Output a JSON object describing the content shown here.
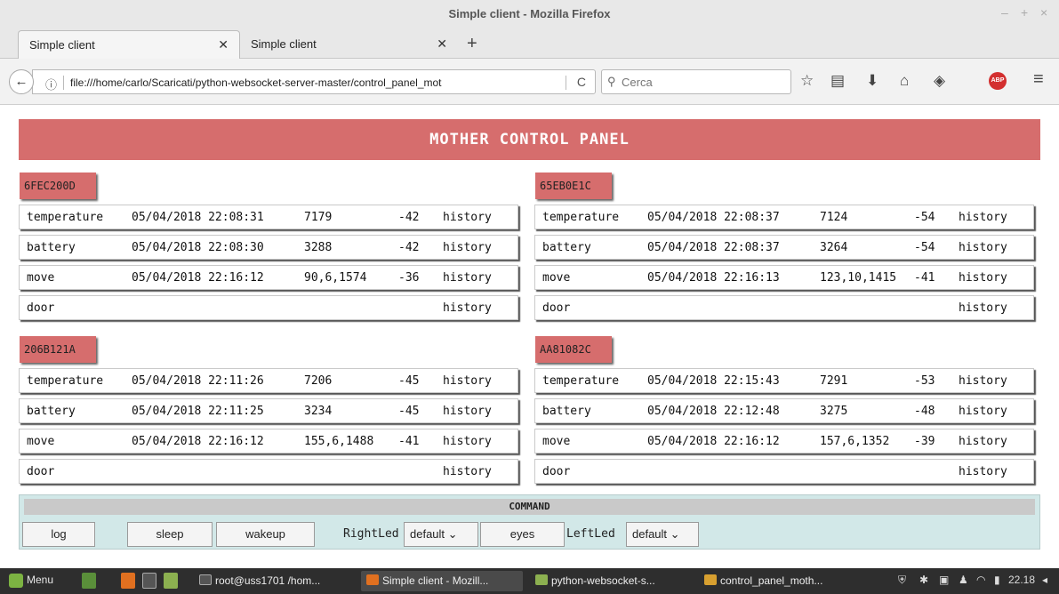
{
  "window": {
    "title": "Simple client - Mozilla Firefox",
    "controls": [
      "–",
      "+",
      "×"
    ]
  },
  "tabs": [
    {
      "label": "Simple client"
    },
    {
      "label": "Simple client"
    }
  ],
  "newtab_label": "+",
  "nav": {
    "back": "←",
    "info": "ⓘ",
    "url": "file:///home/carlo/Scaricati/python-websocket-server-master/control_panel_mot",
    "reload": "C",
    "search_placeholder": "Cerca",
    "search_icon": "⚲",
    "toolbar": {
      "bookmark": "☆",
      "reader": "▤",
      "download": "⬇",
      "home": "⌂",
      "pocket": "◈",
      "abp": "ABP",
      "menu": "≡"
    }
  },
  "page": {
    "banner": "MOTHER CONTROL PANEL",
    "devices": [
      {
        "id": "6FEC200D",
        "rows": [
          {
            "name": "temperature",
            "time": "05/04/2018 22:08:31",
            "value": "7179",
            "rssi": "-42",
            "link": "history"
          },
          {
            "name": "battery",
            "time": "05/04/2018 22:08:30",
            "value": "3288",
            "rssi": "-42",
            "link": "history"
          },
          {
            "name": "move",
            "time": "05/04/2018 22:16:12",
            "value": "90,6,1574",
            "rssi": "-36",
            "link": "history"
          },
          {
            "name": "door",
            "time": "",
            "value": "",
            "rssi": "",
            "link": "history"
          }
        ]
      },
      {
        "id": "65EB0E1C",
        "rows": [
          {
            "name": "temperature",
            "time": "05/04/2018 22:08:37",
            "value": "7124",
            "rssi": "-54",
            "link": "history"
          },
          {
            "name": "battery",
            "time": "05/04/2018 22:08:37",
            "value": "3264",
            "rssi": "-54",
            "link": "history"
          },
          {
            "name": "move",
            "time": "05/04/2018 22:16:13",
            "value": "123,10,1415",
            "rssi": "-41",
            "link": "history"
          },
          {
            "name": "door",
            "time": "",
            "value": "",
            "rssi": "",
            "link": "history"
          }
        ]
      },
      {
        "id": "206B121A",
        "rows": [
          {
            "name": "temperature",
            "time": "05/04/2018 22:11:26",
            "value": "7206",
            "rssi": "-45",
            "link": "history"
          },
          {
            "name": "battery",
            "time": "05/04/2018 22:11:25",
            "value": "3234",
            "rssi": "-45",
            "link": "history"
          },
          {
            "name": "move",
            "time": "05/04/2018 22:16:12",
            "value": "155,6,1488",
            "rssi": "-41",
            "link": "history"
          },
          {
            "name": "door",
            "time": "",
            "value": "",
            "rssi": "",
            "link": "history"
          }
        ]
      },
      {
        "id": "AA81082C",
        "rows": [
          {
            "name": "temperature",
            "time": "05/04/2018 22:15:43",
            "value": "7291",
            "rssi": "-53",
            "link": "history"
          },
          {
            "name": "battery",
            "time": "05/04/2018 22:12:48",
            "value": "3275",
            "rssi": "-48",
            "link": "history"
          },
          {
            "name": "move",
            "time": "05/04/2018 22:16:12",
            "value": "157,6,1352",
            "rssi": "-39",
            "link": "history"
          },
          {
            "name": "door",
            "time": "",
            "value": "",
            "rssi": "",
            "link": "history"
          }
        ]
      }
    ],
    "command": {
      "title": "COMMAND",
      "log": "log",
      "sleep": "sleep",
      "wakeup": "wakeup",
      "right_led_label": "RightLed",
      "right_led_value": "default ⌄",
      "eyes": "eyes",
      "left_led_label": "LeftLed",
      "left_led_value": "default ⌄"
    }
  },
  "taskbar": {
    "menu": "Menu",
    "tasks": [
      {
        "label": "root@uss1701 /hom..."
      },
      {
        "label": "Simple client - Mozill..."
      },
      {
        "label": "python-websocket-s..."
      },
      {
        "label": "control_panel_moth..."
      }
    ],
    "clock": "22.18"
  },
  "colors": {
    "accent_red": "#d66d6d",
    "command_bg": "#d2e8e8",
    "taskbar": "#2e2e2e"
  }
}
